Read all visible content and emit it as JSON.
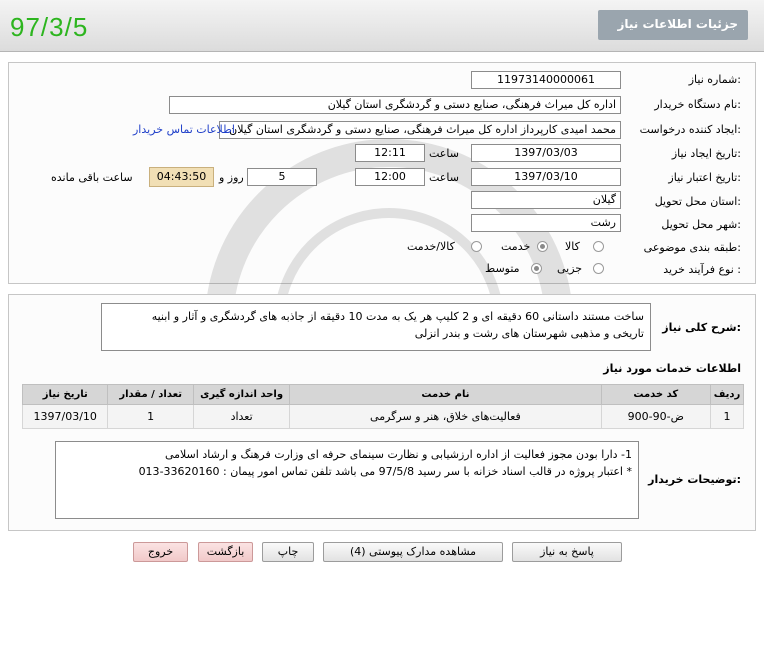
{
  "header": {
    "date": "97/3/5",
    "title": "جزئیات اطلاعات نیاز"
  },
  "form": {
    "need_number": {
      "label": "شماره نیاز:",
      "value": "11973140000061"
    },
    "buyer_org": {
      "label": "نام دستگاه خریدار:",
      "value": "اداره کل میراث فرهنگی، صنایع دستی و گردشگری استان گیلان"
    },
    "requester": {
      "label": "ایجاد کننده درخواست:",
      "value": "محمد امیدی کارپرداز اداره کل میراث فرهنگی، صنایع دستی و گردشگری استان گیلان",
      "contact_link": "اطلاعات تماس خریدار"
    },
    "announce_date": {
      "label": "تاریخ ایجاد نیاز:",
      "date": "1397/03/03",
      "time_label": "ساعت",
      "time": "12:11"
    },
    "validity_date": {
      "label": "تاریخ اعتبار نیاز:",
      "date": "1397/03/10",
      "time_label": "ساعت",
      "time": "12:00",
      "days": "5",
      "days_label": "روز و",
      "remaining": "04:43:50",
      "remaining_label": "ساعت باقی مانده"
    },
    "delivery_province": {
      "label": "استان محل تحویل:",
      "value": "گیلان"
    },
    "delivery_city": {
      "label": "شهر محل تحویل:",
      "value": "رشت"
    },
    "category": {
      "label": "طبقه بندی موضوعی:",
      "options": [
        "کالا",
        "خدمت",
        "کالا/خدمت"
      ],
      "selected": "خدمت"
    },
    "process_type": {
      "label": "نوع فرآیند خرید :",
      "options": [
        "جزیی",
        "متوسط"
      ],
      "selected": "متوسط"
    }
  },
  "description": {
    "label": "شرح کلی نیاز:",
    "line1": "ساخت مستند داستانی 60 دقیقه ای و 2 کلیپ هر یک به مدت 10 دقیقه از جاذبه های گردشگری و آثار و ابنیه",
    "line2": "تاریخی و مذهبی شهرستان های رشت و بندر انزلی"
  },
  "services": {
    "title": "اطلاعات خدمات مورد نیاز",
    "columns": [
      "ردیف",
      "کد خدمت",
      "نام خدمت",
      "واحد اندازه گیری",
      "تعداد / مقدار",
      "تاریخ نیاز"
    ],
    "rows": [
      [
        "1",
        "ض-90-900",
        "فعالیت‌های خلاق، هنر و سرگرمی",
        "تعداد",
        "1",
        "1397/03/10"
      ]
    ]
  },
  "buyer_notes": {
    "label": "توضیحات خریدار:",
    "line1": "1- دارا بودن مجوز فعالیت از اداره ارزشیابی و نظارت سینمای حرفه ای وزارت فرهنگ و ارشاد اسلامی",
    "line2": "* اعتبار پروژه در قالب اسناد خزانه با سر رسید 97/5/8 می باشد  تلفن تماس امور پیمان : 33620160-013"
  },
  "buttons": {
    "reply": "پاسخ به نیاز",
    "attachments": "مشاهده مدارک پیوستی (4)",
    "print": "چاپ",
    "back": "بازگشت",
    "exit": "خروج"
  }
}
